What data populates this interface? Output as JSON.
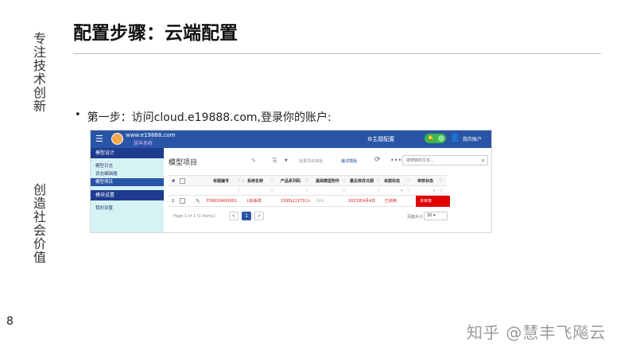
{
  "slide": {
    "title": "配置步骤：云端配置",
    "side_top": "专注技术创新",
    "side_bottom": "创造社会价值",
    "page_number": "8",
    "bullet": "•",
    "step_text": "第一步：访问cloud.e19888.com,登录你的账户:",
    "watermark": "知乎 @慧丰飞飚云"
  },
  "app": {
    "topbar": {
      "bg": "#2a55a6",
      "menu_icon": "☰",
      "logo_url": "www.e19888.com",
      "logo_sub": "慧丰系统",
      "theme_config": "主题配置",
      "toggle_icon": "bell-icon",
      "account": "我的账户"
    },
    "sidebar": {
      "section1": "模型设计",
      "items1": [
        "模型日志",
        "状态编辑器",
        "模型项目"
      ],
      "active_item": "模型项目",
      "section2": "模块设置",
      "items2": [
        "我的设置"
      ]
    },
    "main": {
      "page_title": "模型项目",
      "toolbar": {
        "bulk_label": "批量项目排版",
        "detail_label": "编详模版"
      },
      "search_placeholder": "搜搜索的文本...",
      "grid": {
        "headers": [
          "#",
          "",
          "",
          "单据编号",
          "系统名称",
          "产品系列码",
          "基础模型附件",
          "最近修改日期",
          "单据状态",
          "审核状态"
        ],
        "row": {
          "index": "1",
          "doc_no": "F09050400001",
          "system_name": "Ŀ标系统",
          "product_code": "1595LC/1T1Cn",
          "attachment": "N/A",
          "modified": "2023年4月4日",
          "doc_status": "已启用",
          "audit_status": "未审核"
        }
      },
      "pager": {
        "info": "Page 1 of 1 (1 items)",
        "prev": "<",
        "current": "1",
        "next": ">",
        "size_label": "页面大小",
        "size_value": "20"
      }
    }
  }
}
